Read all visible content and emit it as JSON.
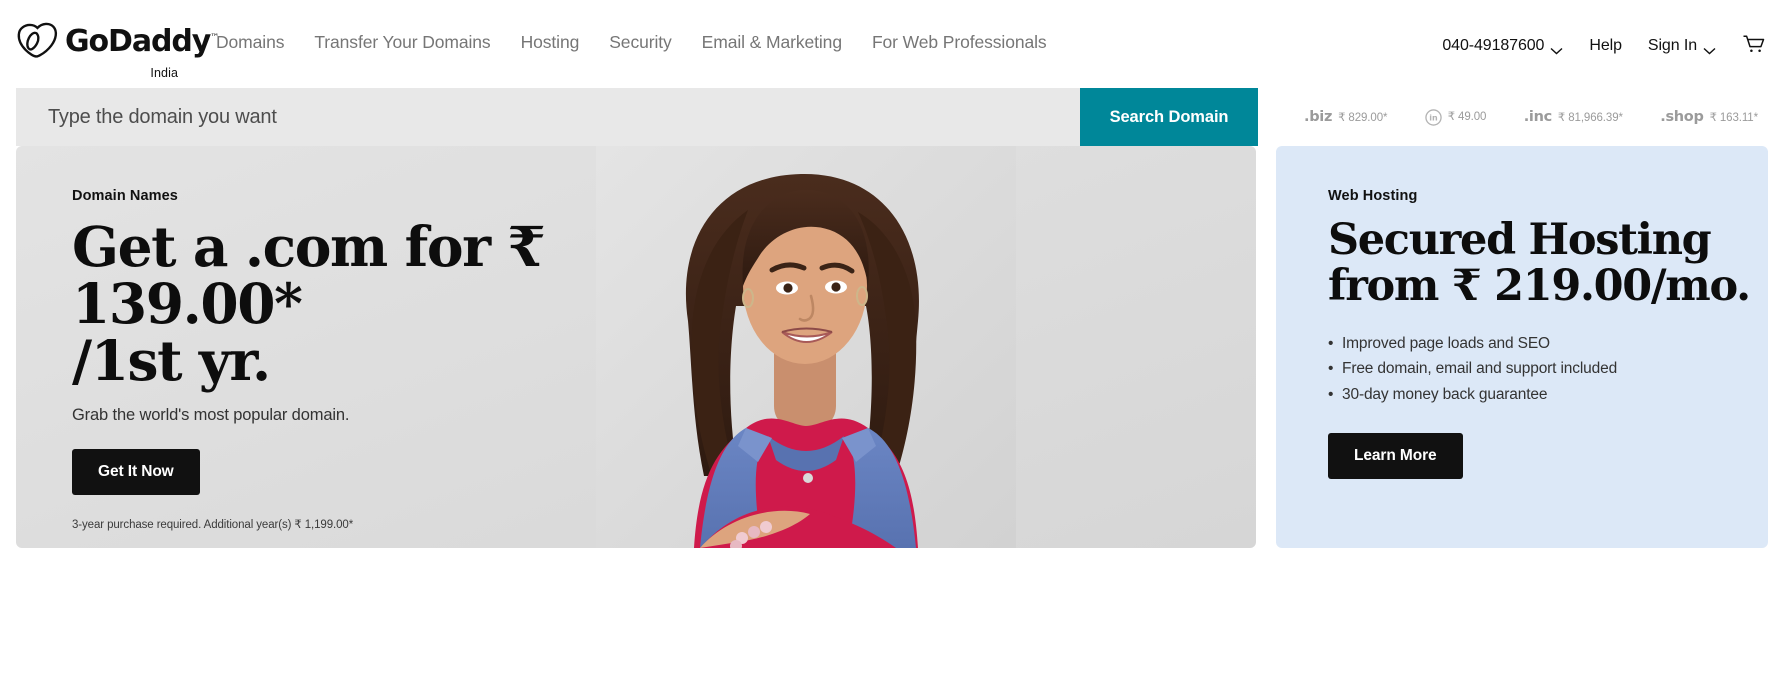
{
  "brand": {
    "logo_word": "GoDaddy",
    "logo_tm": "™",
    "locale": "India",
    "logo_icon": "godaddy-heart-logo"
  },
  "nav": {
    "items": [
      {
        "label": "Domains"
      },
      {
        "label": "Transfer Your Domains"
      },
      {
        "label": "Hosting"
      },
      {
        "label": "Security"
      },
      {
        "label": "Email & Marketing"
      },
      {
        "label": "For Web Professionals"
      }
    ]
  },
  "header_right": {
    "phone": "040-49187600",
    "phone_caret_icon": "chevron-down-icon",
    "help": "Help",
    "sign_in": "Sign In",
    "sign_in_caret_icon": "chevron-down-icon",
    "cart_icon": "shopping-cart-icon"
  },
  "search": {
    "placeholder": "Type the domain you want",
    "value": "",
    "button_label": "Search Domain",
    "button_color": "#008799"
  },
  "tlds": [
    {
      "name": ".biz",
      "price": "₹ 829.00*",
      "icon": null
    },
    {
      "name": ".in",
      "price": "₹ 49.00",
      "icon": "in-circle-icon"
    },
    {
      "name": ".inc",
      "price": "₹ 81,966.39*",
      "icon": null
    },
    {
      "name": ".shop",
      "price": "₹ 163.11*",
      "icon": null
    }
  ],
  "hero_left": {
    "eyebrow": "Domain Names",
    "headline_line1": "Get a .com for ₹ 139.00*",
    "headline_line2": "/1st yr.",
    "subcopy": "Grab the world's most popular domain.",
    "cta_label": "Get It Now",
    "fineprint": "3-year purchase required. Additional year(s) ₹ 1,199.00*",
    "image_alt": "smiling-woman-photo"
  },
  "hero_right": {
    "eyebrow": "Web Hosting",
    "headline_line1": "Secured Hosting",
    "headline_line2": "from ₹ 219.00/mo.",
    "bullets": [
      "Improved page loads and SEO",
      "Free domain, email and support included",
      "30-day money back guarantee"
    ],
    "cta_label": "Learn More",
    "background_color": "#dce8f7"
  }
}
